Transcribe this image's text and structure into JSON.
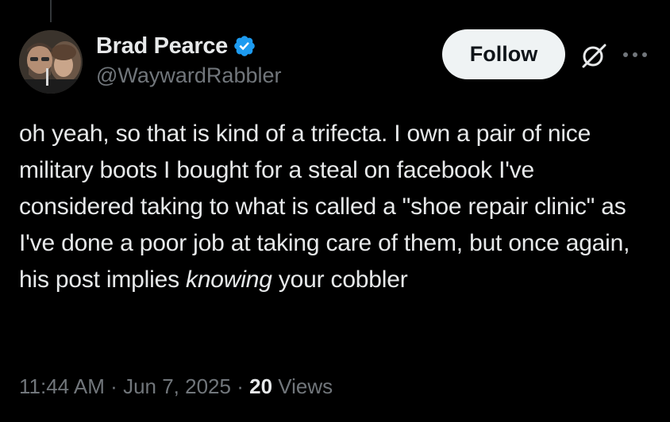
{
  "author": {
    "display_name": "Brad Pearce",
    "handle": "@WaywardRabbler",
    "verified": true
  },
  "actions": {
    "follow_label": "Follow",
    "icons": [
      "grok-icon",
      "more-icon"
    ]
  },
  "tweet": {
    "text_before": "oh yeah, so that is kind of a trifecta. I own a pair of nice military boots I bought for a steal on facebook I've considered taking to what is called a \"shoe repair clinic\" as I've done a poor job at taking care of them, but once again, his post implies ",
    "text_emphasis": "knowing",
    "text_after": " your cobbler"
  },
  "meta": {
    "time": "11:44 AM",
    "separator": "·",
    "date": "Jun 7, 2025",
    "views_count": "20",
    "views_label": "Views"
  },
  "colors": {
    "background": "#000000",
    "text_primary": "#e7e9ea",
    "text_secondary": "#71767b",
    "verified_badge": "#1d9bf0",
    "follow_bg": "#eff3f4"
  }
}
